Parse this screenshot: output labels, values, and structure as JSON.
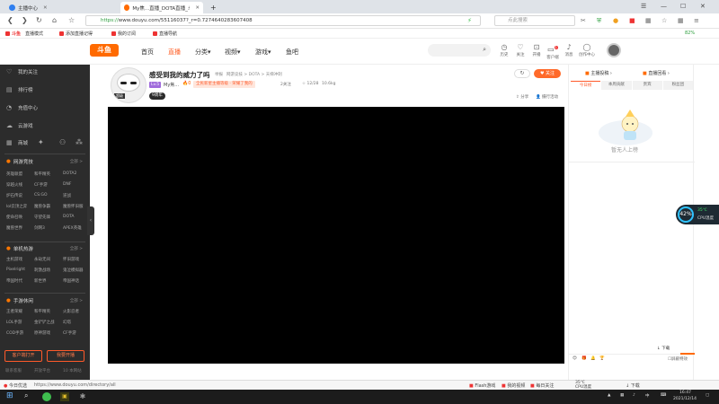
{
  "browser": {
    "tabs": [
      {
        "title": "主播中心",
        "active": false
      },
      {
        "title": "My焦...直播_DOTA直播_斗鱼...",
        "active": true
      }
    ],
    "new_tab": "+",
    "url_scheme": "https://",
    "url_rest": "www.douyu.com/55116037?_r=0.72746402836074​08",
    "search_placeholder": "点此搜索",
    "zoom_badge": "82%",
    "bookmarks": [
      {
        "label": "直播模式"
      },
      {
        "label": "添加直播记得"
      },
      {
        "label": "我的订阅"
      },
      {
        "label": "直播导航"
      }
    ]
  },
  "site": {
    "logo": "斗鱼",
    "nav": [
      {
        "label": "首页",
        "active": false
      },
      {
        "label": "直播",
        "active": true
      },
      {
        "label": "分类▾",
        "active": false
      },
      {
        "label": "视频▾",
        "active": false
      },
      {
        "label": "游戏▾",
        "active": false
      },
      {
        "label": "鱼吧",
        "active": false
      }
    ],
    "header_icons": [
      {
        "icon": "clock-icon",
        "label": "历史"
      },
      {
        "icon": "heart-icon",
        "label": "关注"
      },
      {
        "icon": "bag-icon",
        "label": "开播"
      },
      {
        "icon": "message-icon",
        "label": "客户端"
      },
      {
        "icon": "bell-icon",
        "label": "消息"
      },
      {
        "icon": "bulb-icon",
        "label": "创作中心"
      }
    ]
  },
  "sidebar": {
    "items": [
      {
        "icon": "heart-icon",
        "label": "我的关注"
      },
      {
        "icon": "list-icon",
        "label": "排行榜"
      },
      {
        "icon": "clock-icon",
        "label": "充值中心"
      },
      {
        "icon": "cloud-icon",
        "label": "云游戏"
      },
      {
        "icon": "grid-icon",
        "label": "商城"
      }
    ],
    "section1": {
      "title": "网游竞技",
      "more": "全部 >",
      "links": [
        "英雄联盟",
        "和平精英",
        "DOTA2",
        "穿越火线",
        "CF手游",
        "DNF",
        "炉石传说",
        "CS:GO",
        "逆战",
        "lol云顶之弈",
        "魔兽争霸",
        "魔兽怀旧服",
        "使命召唤",
        "守望先锋",
        "DOTA",
        "魔兽世界",
        "剑网3",
        "APEX英雄"
      ]
    },
    "section2": {
      "title": "单机热游",
      "more": "全部 >",
      "links": [
        "主机游戏",
        "永劫无间",
        "怀旧游戏",
        "Pixelright",
        "刺激战场",
        "鬼泣模拟器",
        "帝国时代",
        "新世界",
        "帝国神话"
      ]
    },
    "section3": {
      "title": "手游休闲",
      "more": "全部 >",
      "links": [
        "王者荣耀",
        "和平精英",
        "火影忍者",
        "LOL手游",
        "金铲铲之战",
        "幻塔",
        "COD手游",
        "原神游戏",
        "CF手游"
      ]
    },
    "btn_client": "客户端打开",
    "btn_live": "我要开播",
    "footer": [
      "联系客服",
      "开放平台",
      "10 本网站"
    ]
  },
  "room": {
    "anchor_avatar_label": "超级",
    "title": "感受到我的威力了吗",
    "report": "举报",
    "breadcrumb": "网游竞技 > DOTA > 天梯冲刺",
    "level": "Lv.5",
    "anchor_name": "My焦...",
    "fire_count": "🔥0",
    "hot_tag": "全民新星主播等级 · 荣耀了我的",
    "fans": "2关注",
    "rank": "☆ 12/28",
    "heat": "10.6kg",
    "badge": "9周年",
    "follow_btn": "♥ 关注",
    "share": "分享",
    "report_btn": "👤 摄行活动"
  },
  "right_panel": {
    "top_left": "主播投稿 ›",
    "top_right": "直播回看 ›",
    "tabs": [
      {
        "label": "今日榜",
        "active": true
      },
      {
        "label": "本周贡献",
        "active": false
      },
      {
        "label": "贵宾",
        "active": false
      },
      {
        "label": "粉丝团",
        "active": false
      }
    ],
    "empty_text": "暂无人上榜",
    "bottom_icons": [
      "😊",
      "🎁",
      "🔔",
      "🏆"
    ],
    "bottom_right": "屏蔽特效",
    "chat_placeholder": "",
    "fans_gift": "下载"
  },
  "float_widget": {
    "pct": "42%",
    "temp": "35℃",
    "label": "CPU温度"
  },
  "statusbar": {
    "left": "今日优选",
    "url": "https://www.douyu.com/directory/all",
    "items": [
      "Flash游戏",
      "我的视频",
      "每日关注"
    ],
    "temp": "35℃",
    "temp_label": "CPU温度",
    "download": "下载"
  },
  "taskbar": {
    "time": "16:47",
    "date": "2021/12/14"
  },
  "colors": {
    "accent": "#ff5d23",
    "sidebar_bg": "#2c2c2c"
  }
}
